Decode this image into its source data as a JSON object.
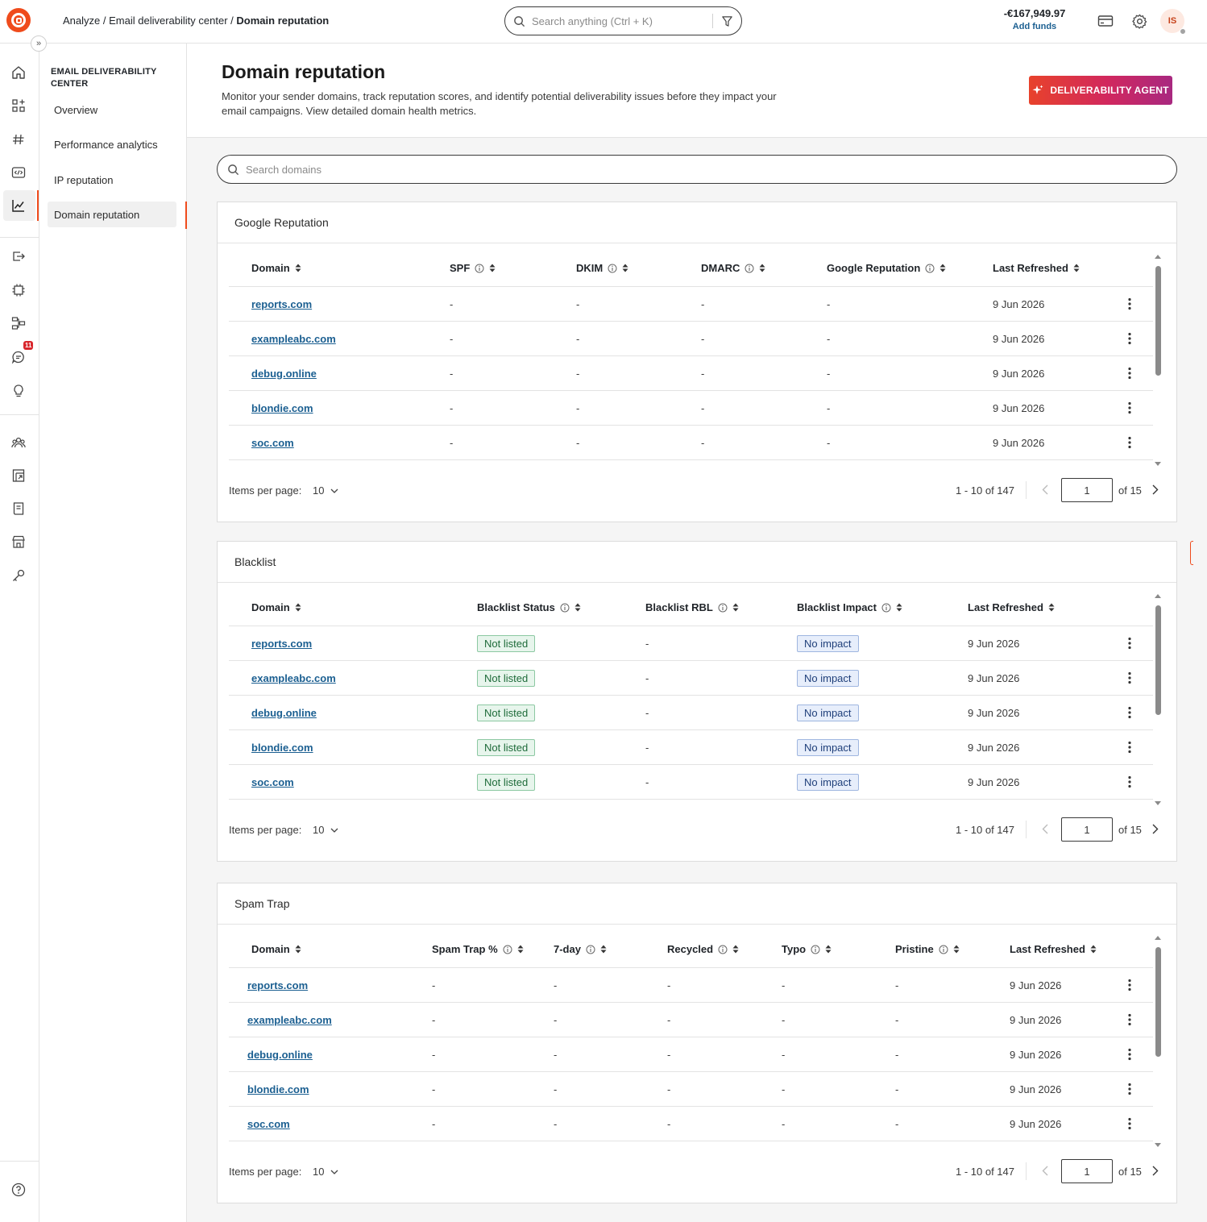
{
  "breadcrumb": {
    "part1": "Analyze",
    "part2": "Email deliverability center",
    "current": "Domain reputation",
    "sep": "/"
  },
  "topbar": {
    "search_placeholder": "Search anything (Ctrl + K)",
    "balance": "-€167,949.97",
    "add_funds": "Add funds",
    "avatar_initials": "IS"
  },
  "rail": {
    "icons": [
      "home-icon",
      "apps-icon",
      "hashtag-icon",
      "code-icon",
      "analytics-icon",
      "send-icon",
      "chip-icon",
      "flow-icon",
      "chat-icon",
      "bulb-icon",
      "people-icon",
      "report-icon",
      "book-icon",
      "store-icon",
      "key-icon",
      "help-icon"
    ],
    "chat_badge": "11"
  },
  "subnav": {
    "heading": "EMAIL DELIVERABILITY CENTER",
    "items": [
      "Overview",
      "Performance analytics",
      "IP reputation",
      "Domain reputation"
    ]
  },
  "page": {
    "title": "Domain reputation",
    "description": "Monitor your sender domains, track reputation scores, and identify potential deliverability issues before they impact your email campaigns. View detailed domain health metrics.",
    "agent_button": "DELIVERABILITY AGENT",
    "search_placeholder": "Search domains"
  },
  "colors": {
    "brand": "#ef4b1c",
    "link": "#1b5f91",
    "badge": "#d8262c"
  },
  "google": {
    "title": "Google Reputation",
    "columns": [
      "Domain",
      "SPF",
      "DKIM",
      "DMARC",
      "Google Reputation",
      "Last Refreshed"
    ],
    "rows": [
      [
        "reports.com",
        "-",
        "-",
        "-",
        "-",
        "9 Jun 2026"
      ],
      [
        "exampleabc.com",
        "-",
        "-",
        "-",
        "-",
        "9 Jun 2026"
      ],
      [
        "debug.online",
        "-",
        "-",
        "-",
        "-",
        "9 Jun 2026"
      ],
      [
        "blondie.com",
        "-",
        "-",
        "-",
        "-",
        "9 Jun 2026"
      ],
      [
        "soc.com",
        "-",
        "-",
        "-",
        "-",
        "9 Jun 2026"
      ]
    ]
  },
  "blacklist": {
    "title": "Blacklist",
    "columns": [
      "Domain",
      "Blacklist Status",
      "Blacklist RBL",
      "Blacklist Impact",
      "Last Refreshed"
    ],
    "rows": [
      [
        "reports.com",
        "Not listed",
        "-",
        "No impact",
        "9 Jun 2026"
      ],
      [
        "exampleabc.com",
        "Not listed",
        "-",
        "No impact",
        "9 Jun 2026"
      ],
      [
        "debug.online",
        "Not listed",
        "-",
        "No impact",
        "9 Jun 2026"
      ],
      [
        "blondie.com",
        "Not listed",
        "-",
        "No impact",
        "9 Jun 2026"
      ],
      [
        "soc.com",
        "Not listed",
        "-",
        "No impact",
        "9 Jun 2026"
      ]
    ]
  },
  "spamtrap": {
    "title": "Spam Trap",
    "columns": [
      "Domain",
      "Spam Trap %",
      "7-day",
      "Recycled",
      "Typo",
      "Pristine",
      "Last Refreshed"
    ],
    "rows": [
      [
        "reports.com",
        "-",
        "-",
        "-",
        "-",
        "-",
        "9 Jun 2026"
      ],
      [
        "exampleabc.com",
        "-",
        "-",
        "-",
        "-",
        "-",
        "9 Jun 2026"
      ],
      [
        "debug.online",
        "-",
        "-",
        "-",
        "-",
        "-",
        "9 Jun 2026"
      ],
      [
        "blondie.com",
        "-",
        "-",
        "-",
        "-",
        "-",
        "9 Jun 2026"
      ],
      [
        "soc.com",
        "-",
        "-",
        "-",
        "-",
        "-",
        "9 Jun 2026"
      ]
    ]
  },
  "pager": {
    "items_label": "Items per page:",
    "items_value": "10",
    "range": "1 - 10 of 147",
    "page": "1",
    "of_pages": "of 15"
  }
}
